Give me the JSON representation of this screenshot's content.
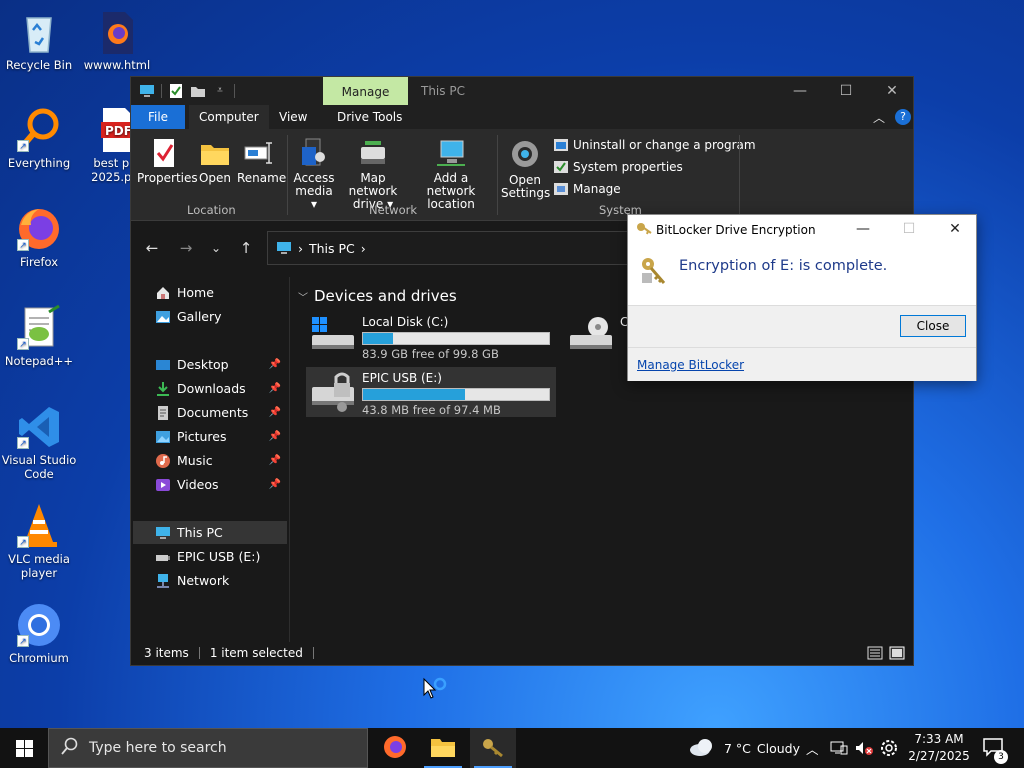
{
  "desktop": {
    "icons": [
      {
        "label": "Recycle Bin"
      },
      {
        "label": "wwww.html"
      },
      {
        "label": "Everything"
      },
      {
        "label": "best p… 2025.p…"
      },
      {
        "label": "Firefox"
      },
      {
        "label": "Notepad++"
      },
      {
        "label": "Visual Studio Code"
      },
      {
        "label": "VLC media player"
      },
      {
        "label": "Chromium"
      }
    ]
  },
  "explorer": {
    "title": "This PC",
    "context_tab": "Manage",
    "tabs": {
      "file": "File",
      "computer": "Computer",
      "view": "View",
      "drive_tools": "Drive Tools"
    },
    "ribbon": {
      "properties": "Properties",
      "open": "Open",
      "rename": "Rename",
      "access_media": "Access media ▾",
      "access_media_l1": "Access",
      "access_media_l2": "media ▾",
      "map_drive_l1": "Map network",
      "map_drive_l2": "drive ▾",
      "add_location_l1": "Add a network",
      "add_location_l2": "location",
      "open_settings_l1": "Open",
      "open_settings_l2": "Settings",
      "uninstall": "Uninstall or change a program",
      "system_properties": "System properties",
      "manage": "Manage",
      "groups": {
        "location": "Location",
        "network": "Network",
        "system": "System"
      }
    },
    "address": {
      "path": "This PC",
      "sep": "›"
    },
    "nav": {
      "home": "Home",
      "gallery": "Gallery",
      "desktop": "Desktop",
      "downloads": "Downloads",
      "documents": "Documents",
      "pictures": "Pictures",
      "music": "Music",
      "videos": "Videos",
      "this_pc": "This PC",
      "usb": "EPIC USB (E:)",
      "network": "Network"
    },
    "section_title": "Devices and drives",
    "drives": [
      {
        "name": "Local Disk (C:)",
        "free": "83.9 GB free of 99.8 GB",
        "used_fraction": 0.16
      },
      {
        "name": "EPIC USB (E:)",
        "free": "43.8 MB free of 97.4 MB",
        "used_fraction": 0.55
      },
      {
        "name": "CI"
      }
    ],
    "status": {
      "items": "3 items",
      "selected": "1 item selected"
    }
  },
  "dialog": {
    "title": "BitLocker Drive Encryption",
    "message": "Encryption of E: is complete.",
    "close": "Close",
    "link": "Manage BitLocker"
  },
  "taskbar": {
    "search_placeholder": "Type here to search",
    "weather_temp": "7 °C",
    "weather_text": "Cloudy",
    "time": "7:33 AM",
    "date": "2/27/2025",
    "notifications": "3"
  },
  "colors": {
    "accent": "#1a6fd6",
    "drive_fill": "#26a0da",
    "manage_tab": "#c4e8a4"
  }
}
